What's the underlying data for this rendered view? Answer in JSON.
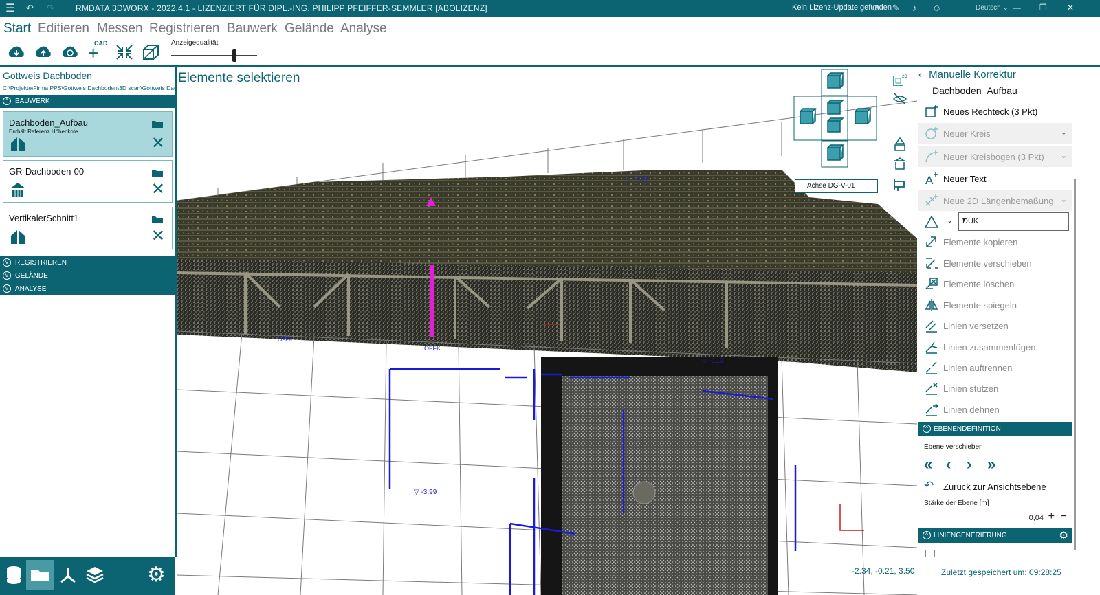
{
  "titlebar": {
    "title": "RMDATA 3DWORX - 2022.4.1 - LIZENZIERT FÜR DIPL.-ING. PHILIPP PFEIFFER-SEMMLER [ABOLIZENZ]",
    "license_status": "Kein Lizenz-Update gefunden",
    "language": "Deutsch",
    "minimize": "—",
    "restore": "❐",
    "close": "✕"
  },
  "menu": {
    "items": [
      "Start",
      "Editieren",
      "Messen",
      "Registrieren",
      "Bauwerk",
      "Gelände",
      "Analyse"
    ]
  },
  "ribbon": {
    "cad_label": "CAD",
    "quality_label": "Anzeigequalität",
    "quality_value": 0.72
  },
  "left": {
    "project_title": "Gottweis Dachboden",
    "project_path": "C:\\Projekte\\Firma PPS\\Gottweis Dachboden\\3D scan\\Gottweis Dachboden",
    "sections": {
      "bauwerk": "BAUWERK",
      "registrieren": "REGISTRIEREN",
      "gelaende": "GELÄNDE",
      "analyse": "ANALYSE"
    },
    "items": [
      {
        "name": "Dachboden_Aufbau",
        "sub": "Enthält Referenz Höhenkote"
      },
      {
        "name": "GR-Dachboden-00",
        "sub": ""
      },
      {
        "name": "VertikalerSchnitt1",
        "sub": ""
      }
    ]
  },
  "viewport": {
    "title": "Elemente selektieren",
    "achse": "Achse DG-V-01",
    "coordinates": "-2.34, -0.21, 3.50",
    "labels": {
      "h1": "▽ +4.67",
      "h2": "▽ -3.99",
      "h3": "▽ -0.19",
      "offk": "OFFK"
    }
  },
  "right": {
    "back_title": "Manuelle Korrektur",
    "subtitle": "Dachboden_Aufbau",
    "tools": [
      {
        "label": "Neues Rechteck (3 Pkt)"
      },
      {
        "label": "Neuer Kreis"
      },
      {
        "label": "Neuer Kreisbogen (3 Pkt)"
      },
      {
        "label": "Neuer Text"
      },
      {
        "label": "Neue 2D Längenbemaßung"
      },
      {
        "label": "Elemente kopieren"
      },
      {
        "label": "Elemente verschieben"
      },
      {
        "label": "Elemente löschen"
      },
      {
        "label": "Elemente spiegeln"
      },
      {
        "label": "Linien versetzen"
      },
      {
        "label": "Linien zusammenfügen"
      },
      {
        "label": "Linien auftrennen"
      },
      {
        "label": "Linien stutzen"
      },
      {
        "label": "Linien dehnen"
      }
    ],
    "duk_value": "DUK",
    "section_ebenen": "EBENENDEFINITION",
    "ebene_verschieben": "Ebene verschieben",
    "zurueck": "Zurück zur Ansichtsebene",
    "staerke_label": "Stärke der Ebene [m]",
    "staerke_value": "0,04",
    "section_linien": "LINIENGENERIERUNG",
    "saved": "Zuletzt gespeichert um: 09:28:25"
  },
  "colors": {
    "accent": "#0c6472",
    "selected": "#a8d7dc"
  }
}
